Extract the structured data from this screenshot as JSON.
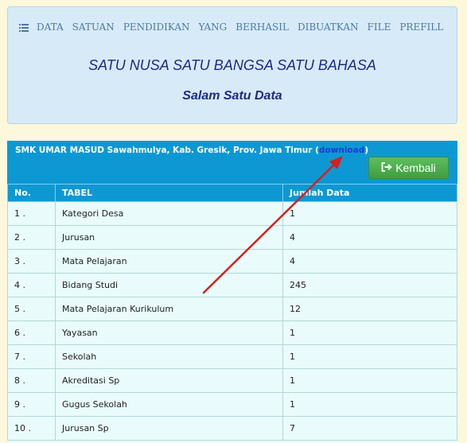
{
  "menu": {
    "icon": "list-icon",
    "items": [
      "DATA",
      "SATUAN",
      "PENDIDIKAN",
      "YANG",
      "BERHASIL",
      "DIBUATKAN",
      "FILE",
      "PREFILL"
    ]
  },
  "banner": {
    "slogan": "SATU NUSA SATU BANGSA SATU BAHASA",
    "subtitle": "Salam Satu Data"
  },
  "panel": {
    "school": "SMK UMAR MASUD Sawahmulya, Kab. Gresik, Prov. Jawa Timur (",
    "download_label": "download",
    "close_paren": ")",
    "back_button": "Kembali",
    "back_icon": "sign-out-icon"
  },
  "table": {
    "headers": [
      "No.",
      "TABEL",
      "Jumlah Data"
    ],
    "rows": [
      {
        "no": "1 .",
        "tabel": "Kategori Desa",
        "jumlah": "1"
      },
      {
        "no": "2 .",
        "tabel": "Jurusan",
        "jumlah": "4"
      },
      {
        "no": "3 .",
        "tabel": "Mata Pelajaran",
        "jumlah": "4"
      },
      {
        "no": "4 .",
        "tabel": "Bidang Studi",
        "jumlah": "245"
      },
      {
        "no": "5 .",
        "tabel": "Mata Pelajaran Kurikulum",
        "jumlah": "12"
      },
      {
        "no": "6 .",
        "tabel": "Yayasan",
        "jumlah": "1"
      },
      {
        "no": "7 .",
        "tabel": "Sekolah",
        "jumlah": "1"
      },
      {
        "no": "8 .",
        "tabel": "Akreditasi Sp",
        "jumlah": "1"
      },
      {
        "no": "9 .",
        "tabel": "Gugus Sekolah",
        "jumlah": "1"
      },
      {
        "no": "10 .",
        "tabel": "Jurusan Sp",
        "jumlah": "7"
      }
    ]
  },
  "colors": {
    "header_blue": "#0e98d3",
    "annotation_arrow": "#d61f1f",
    "button_green": "#4cae4c"
  }
}
